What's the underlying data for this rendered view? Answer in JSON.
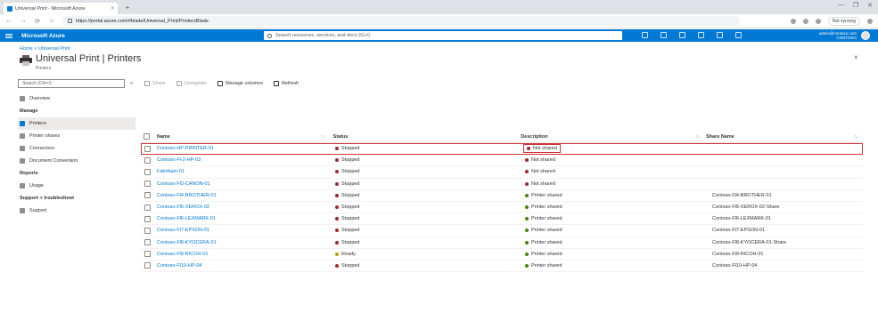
{
  "browser": {
    "tab_title": "Universal Print - Microsoft Azure",
    "tab_close": "×",
    "new_tab": "+",
    "url": "https://portal.azure.com/#blade/Universal_Print/PrintersBlade",
    "profile_label": "Not syncing",
    "window_controls": [
      "—",
      "❐",
      "✕"
    ],
    "nav": [
      "←",
      "→",
      "⟳",
      "⌂"
    ]
  },
  "portal": {
    "brand": "Microsoft Azure",
    "search_placeholder": "Search resources, services, and docs (G+/)",
    "account_line1": "admin@contoso.com",
    "account_line2": "CONTOSO"
  },
  "page": {
    "breadcrumb": "Home > Universal Print",
    "title_main": "Universal Print",
    "title_suffix": " | Printers",
    "subtitle": "Printers",
    "close": "×"
  },
  "nav": {
    "search_placeholder": "Search (Ctrl+/)",
    "collapse": "«",
    "items": [
      {
        "type": "item",
        "label": "Overview",
        "icon": "overview-icon",
        "selected": false
      },
      {
        "type": "section",
        "label": "Manage"
      },
      {
        "type": "item",
        "label": "Printers",
        "icon": "printer-icon",
        "selected": true
      },
      {
        "type": "item",
        "label": "Printer shares",
        "icon": "share-icon",
        "selected": false
      },
      {
        "type": "item",
        "label": "Connectors",
        "icon": "connector-icon",
        "selected": false
      },
      {
        "type": "item",
        "label": "Document Conversion",
        "icon": "document-icon",
        "selected": false
      },
      {
        "type": "section",
        "label": "Reports"
      },
      {
        "type": "item",
        "label": "Usage",
        "icon": "usage-icon",
        "selected": false
      },
      {
        "type": "section",
        "label": "Support + troubleshoot"
      },
      {
        "type": "item",
        "label": "Support",
        "icon": "support-icon",
        "selected": false
      }
    ]
  },
  "commands": [
    {
      "label": "Share",
      "icon": "share-icon",
      "disabled": true
    },
    {
      "label": "Unregister",
      "icon": "unregister-icon",
      "disabled": true
    },
    {
      "label": "Manage columns",
      "icon": "columns-icon",
      "disabled": false
    },
    {
      "label": "Refresh",
      "icon": "refresh-icon",
      "disabled": false
    }
  ],
  "table": {
    "headers": {
      "name": "Name",
      "status": "Status",
      "description": "Description",
      "share": "Share Name"
    },
    "sort_indicator": "↑↓",
    "rows": [
      {
        "name": "Contoso-HP-PRINTER-01",
        "status": "Stopped",
        "description": "Not shared",
        "share": "",
        "status_color": "#a4262c",
        "desc_color": "#a4262c",
        "highlight": true
      },
      {
        "name": "Contoso-Fl-2-HP-03",
        "status": "Stopped",
        "description": "Not shared",
        "share": "",
        "status_color": "#a4262c",
        "desc_color": "#a4262c",
        "highlight": false
      },
      {
        "name": "Fabrikam-01",
        "status": "Stopped",
        "description": "Not shared",
        "share": "",
        "status_color": "#a4262c",
        "desc_color": "#a4262c",
        "highlight": false
      },
      {
        "name": "Contoso-Fl3-CANON-01",
        "status": "Stopped",
        "description": "Not shared",
        "share": "",
        "status_color": "#a4262c",
        "desc_color": "#a4262c",
        "highlight": false
      },
      {
        "name": "Contoso-Fl4-BROTHER-01",
        "status": "Stopped",
        "description": "Printer shared",
        "share": "Contoso-Fl4-BROTHER-01",
        "status_color": "#a4262c",
        "desc_color": "#498205",
        "highlight": false
      },
      {
        "name": "Contoso-Fl5-XEROX-02",
        "status": "Stopped",
        "description": "Printer shared",
        "share": "Contoso-Fl5-XEROX-02-Share",
        "status_color": "#a4262c",
        "desc_color": "#498205",
        "highlight": false
      },
      {
        "name": "Contoso-Fl6-LEXMARK-01",
        "status": "Stopped",
        "description": "Printer shared",
        "share": "Contoso-Fl6-LEXMARK-01",
        "status_color": "#a4262c",
        "desc_color": "#498205",
        "highlight": false
      },
      {
        "name": "Contoso-Fl7-EPSON-01",
        "status": "Stopped",
        "description": "Printer shared",
        "share": "Contoso-Fl7-EPSON-01",
        "status_color": "#a4262c",
        "desc_color": "#498205",
        "highlight": false
      },
      {
        "name": "Contoso-Fl8-KYOCERA-01",
        "status": "Stopped",
        "description": "Printer shared",
        "share": "Contoso-Fl8-KYOCERA-01-Share",
        "status_color": "#a4262c",
        "desc_color": "#498205",
        "highlight": false
      },
      {
        "name": "Contoso-Fl9-RICOH-01",
        "status": "Ready",
        "description": "Printer shared",
        "share": "Contoso-Fl9-RICOH-01",
        "status_color": "#c19c00",
        "desc_color": "#498205",
        "highlight": false
      },
      {
        "name": "Contoso-Fl10-HP-04",
        "status": "Stopped",
        "description": "Printer shared",
        "share": "Contoso-Fl10-HP-04",
        "status_color": "#a4262c",
        "desc_color": "#498205",
        "highlight": false
      }
    ]
  }
}
